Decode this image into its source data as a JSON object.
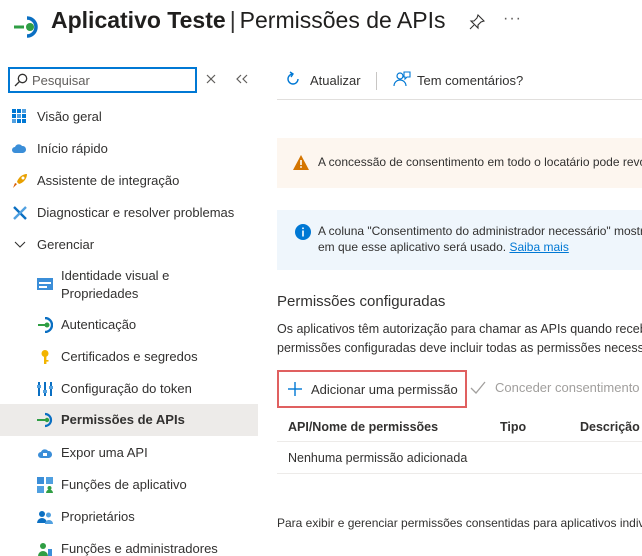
{
  "header": {
    "app_name": "Aplicativo Teste",
    "separator": "|",
    "page_name": "Permissões de APIs",
    "more_label": "···"
  },
  "sidebar": {
    "search_placeholder": "Pesquisar",
    "items": [
      {
        "label": "Visão geral"
      },
      {
        "label": "Início rápido"
      },
      {
        "label": "Assistente de integração"
      },
      {
        "label": "Diagnosticar e resolver problemas"
      },
      {
        "label": "Gerenciar"
      },
      {
        "label_line1": "Identidade visual e",
        "label_line2": "Propriedades"
      },
      {
        "label": "Autenticação"
      },
      {
        "label": "Certificados e segredos"
      },
      {
        "label": "Configuração do token"
      },
      {
        "label": "Permissões de APIs"
      },
      {
        "label": "Expor uma API"
      },
      {
        "label": "Funções de aplicativo"
      },
      {
        "label": "Proprietários"
      },
      {
        "label": "Funções e administradores"
      }
    ]
  },
  "toolbar": {
    "refresh_label": "Atualizar",
    "feedback_label": "Tem comentários?"
  },
  "banners": {
    "warning_text": "A concessão de consentimento em todo o locatário pode revogar permissões",
    "info_line1": "A coluna \"Consentimento do administrador necessário\" mostra o valor padrão",
    "info_line2": "em que esse aplicativo será usado.",
    "info_link": "Saiba mais"
  },
  "permissions": {
    "title": "Permissões configuradas",
    "desc_line1": "Os aplicativos têm autorização para chamar as APIs quando recebem permissões",
    "desc_line2": "permissões configuradas deve incluir todas as permissões necessárias",
    "add_label": "Adicionar uma permissão",
    "grant_label": "Conceder consentimento do administrador",
    "columns": [
      "API/Nome de permissões",
      "Tipo",
      "Descrição"
    ],
    "empty_row": "Nenhuma permissão adicionada",
    "footer": "Para exibir e gerenciar permissões consentidas para aplicativos individuais"
  },
  "colors": {
    "accent": "#0078d4",
    "warning": "#d47500",
    "highlight_border": "#e06060"
  }
}
